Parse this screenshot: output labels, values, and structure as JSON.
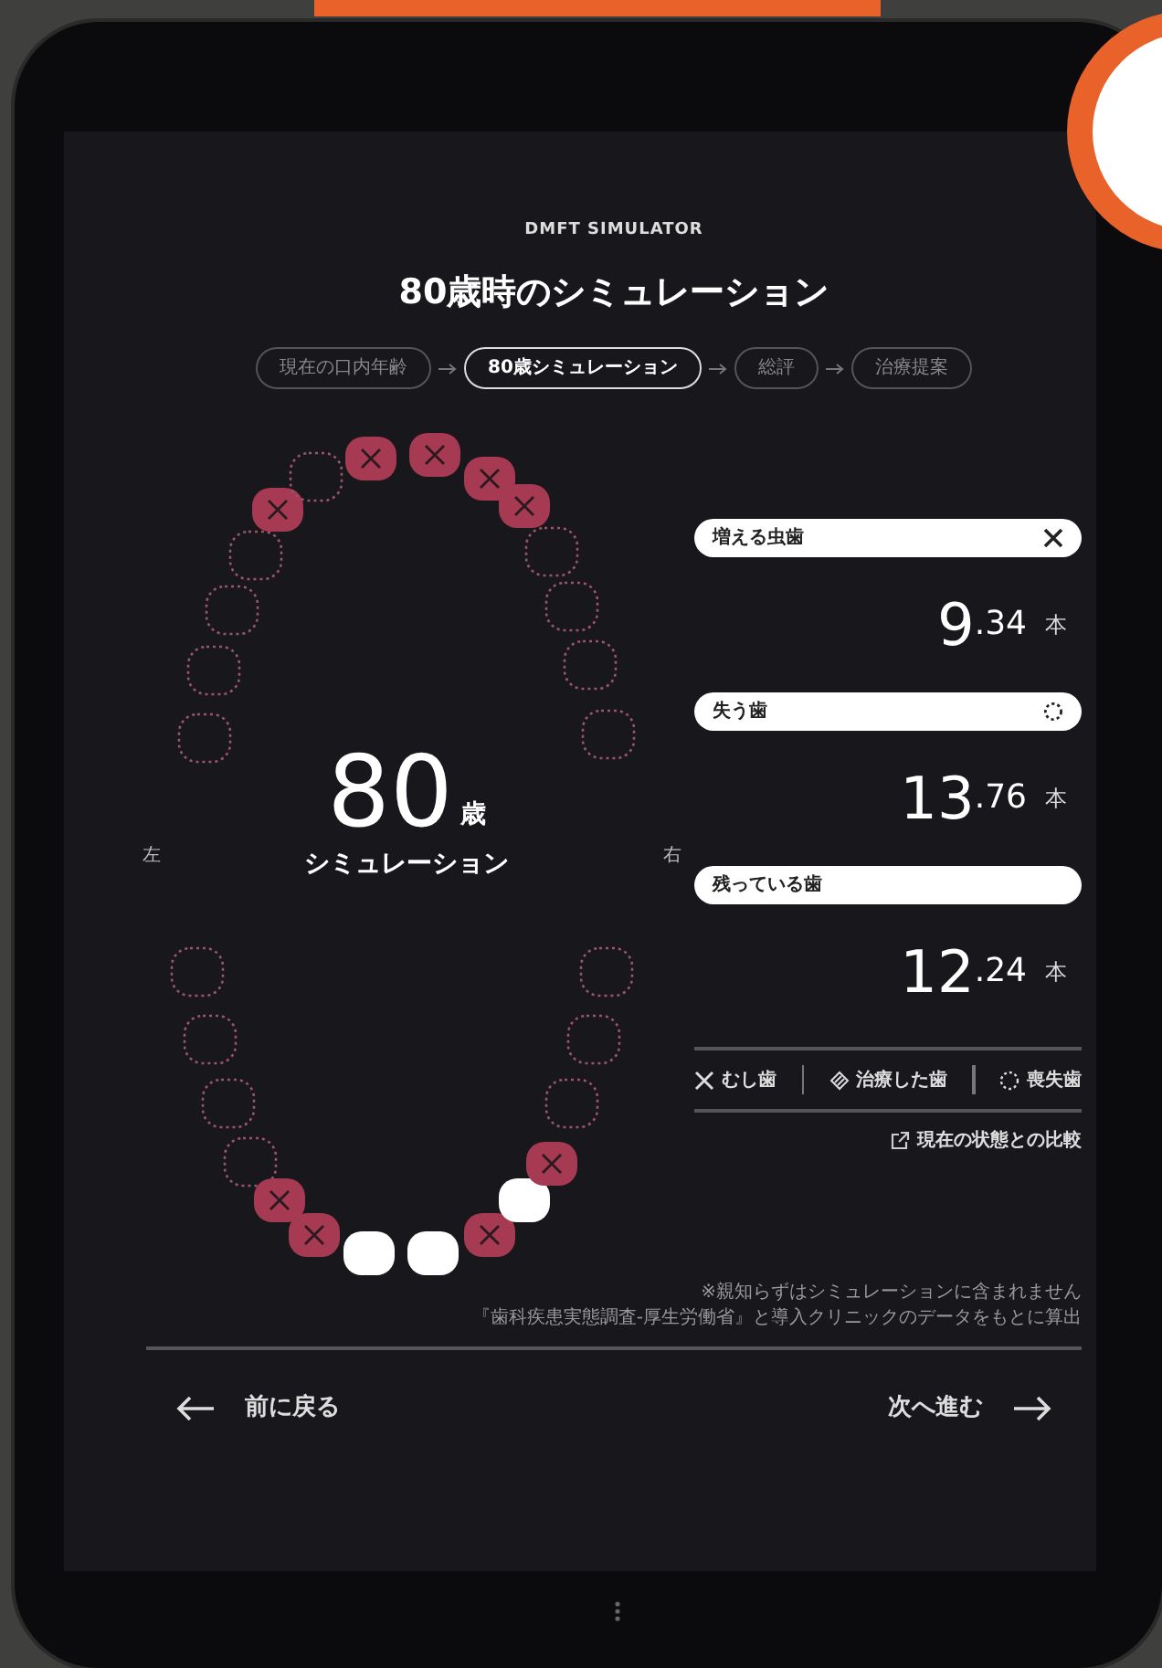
{
  "app_title": "DMFT SIMULATOR",
  "heading": "80歳時のシミュレーション",
  "steps": [
    {
      "label": "現在の口内年齢",
      "selected": false
    },
    {
      "label": "80歳シミュレーション",
      "selected": true
    },
    {
      "label": "総評",
      "selected": false
    },
    {
      "label": "治療提案",
      "selected": false
    }
  ],
  "chart": {
    "age": "80",
    "age_unit": "歳",
    "caption": "シミュレーション",
    "left_label": "左",
    "right_label": "右",
    "upper_teeth": [
      {
        "kind": "lost"
      },
      {
        "kind": "lost"
      },
      {
        "kind": "lost"
      },
      {
        "kind": "lost"
      },
      {
        "kind": "decayed"
      },
      {
        "kind": "lost"
      },
      {
        "kind": "decayed"
      },
      {
        "kind": "decayed"
      },
      {
        "kind": "decayed"
      },
      {
        "kind": "decayed"
      },
      {
        "kind": "lost"
      },
      {
        "kind": "lost"
      },
      {
        "kind": "lost"
      },
      {
        "kind": "lost"
      }
    ],
    "lower_teeth": [
      {
        "kind": "lost"
      },
      {
        "kind": "lost"
      },
      {
        "kind": "lost"
      },
      {
        "kind": "lost"
      },
      {
        "kind": "decayed"
      },
      {
        "kind": "decayed"
      },
      {
        "kind": "healthy"
      },
      {
        "kind": "healthy"
      },
      {
        "kind": "decayed"
      },
      {
        "kind": "healthy"
      },
      {
        "kind": "decayed"
      },
      {
        "kind": "lost"
      },
      {
        "kind": "lost"
      },
      {
        "kind": "lost"
      }
    ]
  },
  "stats": [
    {
      "kind": "decay",
      "label": "増える虫歯",
      "integer": "9",
      "decimal": ".34",
      "unit": "本"
    },
    {
      "kind": "lost",
      "label": "失う歯",
      "integer": "13",
      "decimal": ".76",
      "unit": "本"
    },
    {
      "kind": "remaining",
      "label": "残っている歯",
      "integer": "12",
      "decimal": ".24",
      "unit": "本"
    }
  ],
  "legend": [
    {
      "kind": "decay",
      "label": "むし歯"
    },
    {
      "kind": "treated",
      "label": "治療した歯"
    },
    {
      "kind": "lost",
      "label": "喪失歯"
    }
  ],
  "compare_link": "現在の状態との比較",
  "notes": [
    "※親知らずはシミュレーションに含まれません",
    "『歯科疾患実態調査-厚生労働省』と導入クリニックのデータをもとに算出"
  ],
  "nav": {
    "back": "前に戻る",
    "next": "次へ進む"
  }
}
